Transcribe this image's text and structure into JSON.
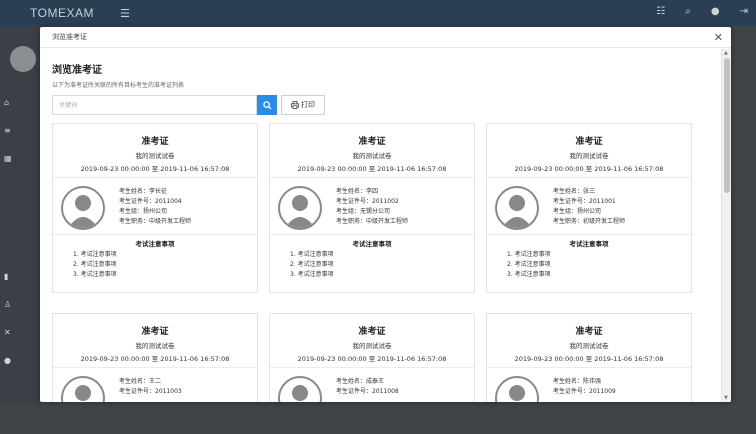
{
  "app": {
    "logo": "TOMEXAM"
  },
  "modal": {
    "title": "浏览准考证",
    "heading": "浏览准考证",
    "subtitle": "以下为准考证所关联的所有目标考生的准考证列表",
    "search_placeholder": "关键词",
    "print_label": "打印"
  },
  "labels": {
    "card_title": "准考证",
    "name": "考生姓名：",
    "id": "考生证件号：",
    "group": "考生组：",
    "position": "考生职务：",
    "notes_title": "考试注意事项"
  },
  "cards": [
    {
      "paper": "我的测试试卷",
      "time": "2019-09-23 00:00:00 至 2019-11-06 16:57:08",
      "name": "李长征",
      "id": "2011004",
      "group": "扬州公司",
      "position": "中级开发工程师",
      "notes": [
        "1. 考试注意事项",
        "2. 考试注意事项",
        "3. 考试注意事项"
      ]
    },
    {
      "paper": "我的测试试卷",
      "time": "2019-09-23 00:00:00 至 2019-11-06 16:57:08",
      "name": "李四",
      "id": "2011002",
      "group": "无锡分公司",
      "position": "中级开发工程师",
      "notes": [
        "1. 考试注意事项",
        "2. 考试注意事项",
        "3. 考试注意事项"
      ]
    },
    {
      "paper": "我的测试试卷",
      "time": "2019-09-23 00:00:00 至 2019-11-06 16:57:08",
      "name": "张三",
      "id": "2011001",
      "group": "扬州公司",
      "position": "初级开发工程师",
      "notes": [
        "1. 考试注意事项",
        "2. 考试注意事项",
        "3. 考试注意事项"
      ]
    },
    {
      "paper": "我的测试试卷",
      "time": "2019-09-23 00:00:00 至 2019-11-06 16:57:08",
      "name": "王二",
      "id": "2011003"
    },
    {
      "paper": "我的测试试卷",
      "time": "2019-09-23 00:00:00 至 2019-11-06 16:57:08",
      "name": "成泰王",
      "id": "2011008"
    },
    {
      "paper": "我的测试试卷",
      "time": "2019-09-23 00:00:00 至 2019-11-06 16:57:08",
      "name": "陈伟强",
      "id": "2011009"
    }
  ],
  "colors": {
    "primary": "#2b8ce5",
    "topbar": "#2a3f54"
  }
}
